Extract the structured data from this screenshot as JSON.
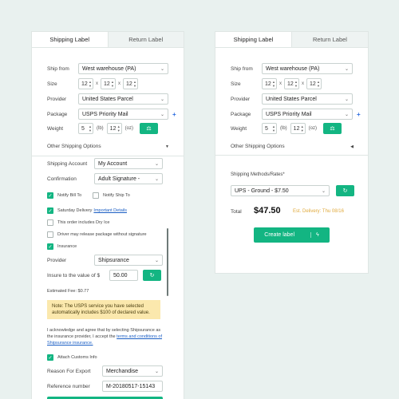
{
  "left": {
    "tabs": [
      "Shipping Label",
      "Return Label"
    ],
    "ship_from": {
      "label": "Ship from",
      "value": "West warehouse (PA)"
    },
    "size": {
      "label": "Size",
      "dims": [
        "12",
        "12",
        "12"
      ],
      "sep": "x"
    },
    "provider": {
      "label": "Provider",
      "value": "United States Parcel"
    },
    "package": {
      "label": "Package",
      "value": "USPS Priority Mail",
      "add": "+"
    },
    "weight": {
      "label": "Weight",
      "lb": "5",
      "lb_unit": "(lb)",
      "oz": "12",
      "oz_unit": "(oz)"
    },
    "other_options": {
      "label": "Other Shipping Options",
      "arrow": "▼"
    },
    "shipping_account": {
      "label": "Shipping Account",
      "value": "My Account"
    },
    "confirmation": {
      "label": "Confirmation",
      "value": "Adult Signature -"
    },
    "notify_bill_to": {
      "label": "Notify Bill To",
      "checked": true
    },
    "notify_ship_to": {
      "label": "Notify Ship To",
      "checked": false
    },
    "saturday": {
      "label": "Saturday Delivery",
      "link": "Important Details",
      "checked": true
    },
    "dry_ice": {
      "label": "This order includes Dry Ice",
      "checked": false
    },
    "driver_release": {
      "label": "Driver may release package without signature",
      "checked": false
    },
    "insurance": {
      "label": "Insurance",
      "checked": true
    },
    "ins_provider": {
      "label": "Provider",
      "value": "Shipsurance"
    },
    "insure_value": {
      "label": "Insure to the value of $",
      "value": "50.00"
    },
    "estimated_fee": "Estimated Fee: $0.77",
    "note": "Note: The USPS service you have selected automatically includes $100 of declared value.",
    "ack_text": "I acknowledge and agree that by selecting Shipsurance as the insurance provider, I accept the",
    "ack_link": "terms and conditions of Shipsurance insurance.",
    "customs": {
      "label": "Attach Customs Info",
      "checked": true
    },
    "reason": {
      "label": "Reason For Export",
      "value": "Merchandise"
    },
    "reference": {
      "label": "Reference number",
      "value": "M-20180517-15143"
    }
  },
  "right": {
    "tabs": [
      "Shipping Label",
      "Return Label"
    ],
    "ship_from": {
      "label": "Ship from",
      "value": "West warehouse (PA)"
    },
    "size": {
      "label": "Size",
      "dims": [
        "12",
        "12",
        "12"
      ],
      "sep": "x"
    },
    "provider": {
      "label": "Provider",
      "value": "United States Parcel"
    },
    "package": {
      "label": "Package",
      "value": "USPS Priority Mail",
      "add": "+"
    },
    "weight": {
      "label": "Weight",
      "lb": "5",
      "lb_unit": "(lb)",
      "oz": "12",
      "oz_unit": "(oz)"
    },
    "other_options": {
      "label": "Other Shipping Options",
      "arrow": "◀"
    },
    "methods_label": "Shipping Methods/Rates*",
    "method": "UPS - Ground - $7.50",
    "total_label": "Total",
    "total_value": "$47.50",
    "est_delivery": "Est. Delivery: Thu 08/16",
    "create_label": "Create label"
  },
  "colors": {
    "accent": "#13b582",
    "link": "#1c5fc4",
    "note_bg": "#fbe8ad",
    "est": "#e0a93b"
  }
}
